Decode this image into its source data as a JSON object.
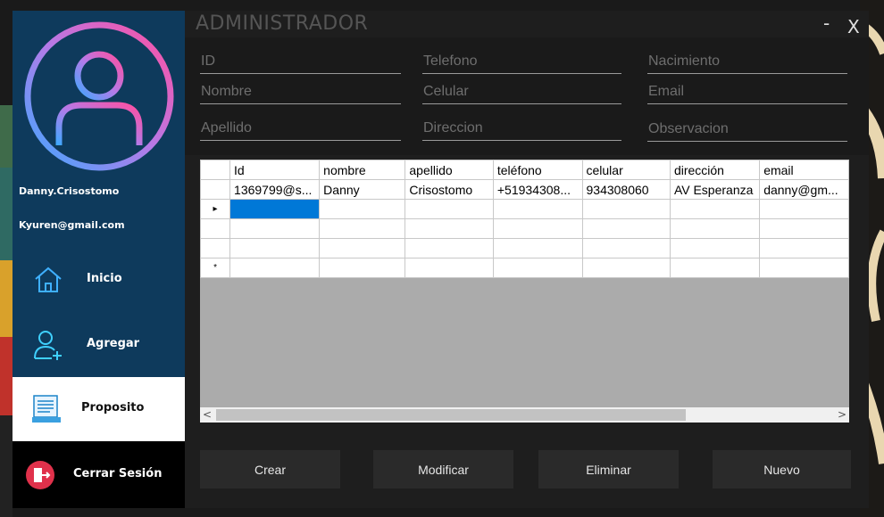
{
  "window": {
    "title": "ADMINISTRADOR",
    "minimize_label": "-",
    "close_label": "X"
  },
  "user": {
    "name": "Danny.Crisostomo",
    "email": "Kyuren@gmail.com"
  },
  "nav": {
    "inicio": "Inicio",
    "agregar": "Agregar",
    "proposito": "Proposito",
    "cerrar": "Cerrar Sesión"
  },
  "form": {
    "id_placeholder": "ID",
    "telefono_placeholder": "Telefono",
    "nacimiento_placeholder": "Nacimiento",
    "nombre_placeholder": "Nombre",
    "celular_placeholder": "Celular",
    "email_placeholder": "Email",
    "apellido_placeholder": "Apellido",
    "direccion_placeholder": "Direccion",
    "observacion_placeholder": "Observacion"
  },
  "grid": {
    "columns": [
      "Id",
      "nombre",
      "apellido",
      "teléfono",
      "celular",
      "dirección",
      "email"
    ],
    "rows": [
      [
        "1369799@s...",
        "Danny",
        "Crisostomo",
        "+51934308...",
        "934308060",
        "AV Esperanza",
        "danny@gm..."
      ]
    ],
    "current_row_marker": "▸",
    "new_row_marker": "*",
    "scroll_left": "<",
    "scroll_right": ">"
  },
  "actions": {
    "crear": "Crear",
    "modificar": "Modificar",
    "eliminar": "Eliminar",
    "nuevo": "Nuevo"
  },
  "colors": {
    "sidebar": "#0e3a5c",
    "selection": "#0078d7",
    "avatar_gradient_start": "#ff4fa0",
    "avatar_gradient_end": "#3fa8ff"
  }
}
